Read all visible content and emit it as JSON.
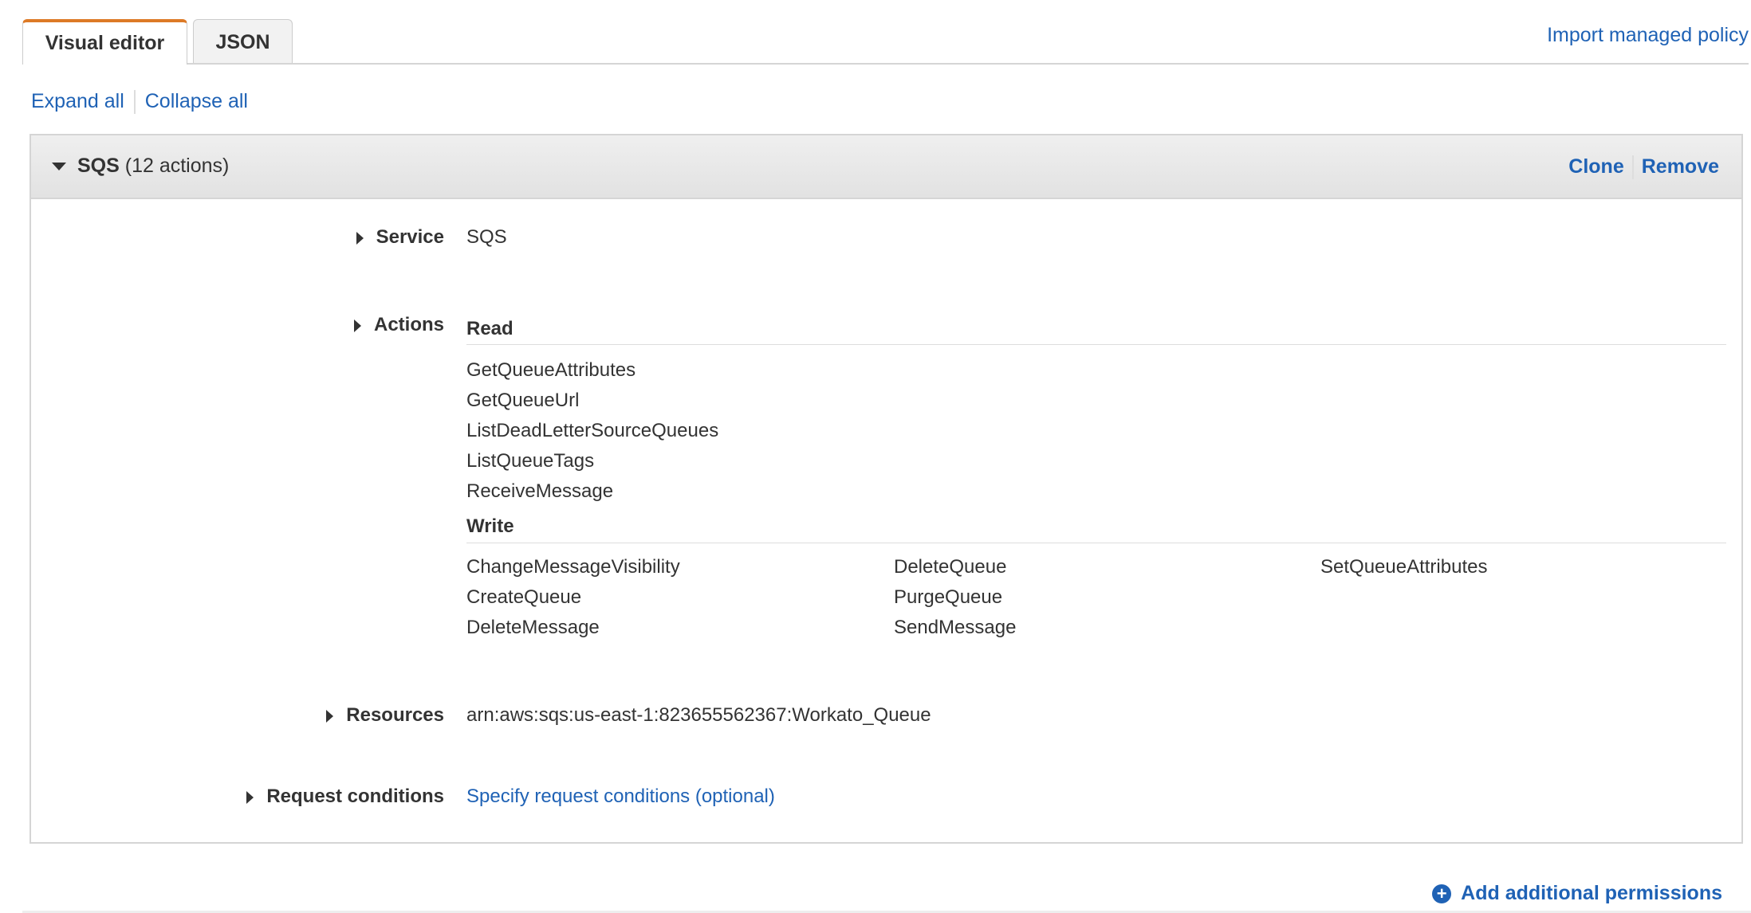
{
  "tabs": [
    {
      "label": "Visual editor",
      "active": true
    },
    {
      "label": "JSON",
      "active": false
    }
  ],
  "import_link": "Import managed policy",
  "expand_all": "Expand all",
  "collapse_all": "Collapse all",
  "statement": {
    "service_name": "SQS",
    "action_count": "(12 actions)",
    "clone": "Clone",
    "remove": "Remove",
    "service_label": "Service",
    "service_value": "SQS",
    "actions_label": "Actions",
    "read_heading": "Read",
    "read_actions": [
      "GetQueueAttributes",
      "GetQueueUrl",
      "ListDeadLetterSourceQueues",
      "ListQueueTags",
      "ReceiveMessage"
    ],
    "write_heading": "Write",
    "write_actions": [
      [
        "ChangeMessageVisibility",
        "CreateQueue",
        "DeleteMessage"
      ],
      [
        "DeleteQueue",
        "PurgeQueue",
        "SendMessage"
      ],
      [
        "SetQueueAttributes"
      ]
    ],
    "resources_label": "Resources",
    "resources_value": "arn:aws:sqs:us-east-1:823655562367:Workato_Queue",
    "conditions_label": "Request conditions",
    "conditions_link": "Specify request conditions (optional)"
  },
  "add_permissions": "Add additional permissions",
  "colors": {
    "accent": "#dd7a26",
    "link": "#1f62b5"
  }
}
